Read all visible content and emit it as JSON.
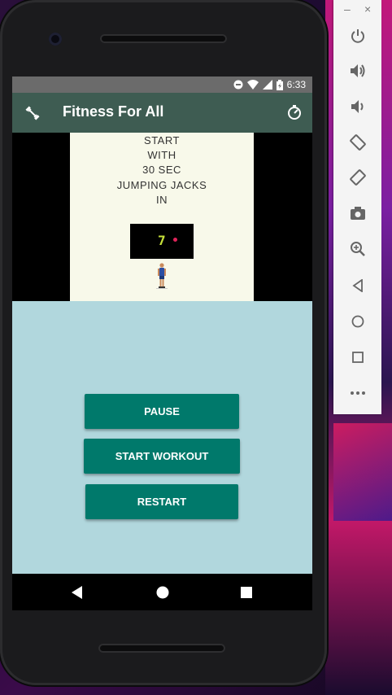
{
  "status_bar": {
    "time": "6:33"
  },
  "app_bar": {
    "title": "Fitness For All"
  },
  "exercise_card": {
    "lines": [
      "START",
      "WITH",
      "30 SEC",
      "JUMPING JACKS",
      "IN"
    ],
    "countdown": "7"
  },
  "buttons": {
    "pause": "PAUSE",
    "start_workout": "START WORKOUT",
    "restart": "RESTART"
  },
  "emulator_toolbar": {
    "minimize": "–",
    "close": "×",
    "items": [
      "power-icon",
      "volume-up-icon",
      "volume-down-icon",
      "rotate-left-icon",
      "rotate-right-icon",
      "camera-icon",
      "zoom-icon",
      "back-icon",
      "home-icon",
      "overview-icon",
      "more-icon"
    ]
  },
  "colors": {
    "app_bar": "#3e5c52",
    "button": "#00796b",
    "controls_bg": "#b1d7dd",
    "card_bg": "#f8f9ea",
    "timer_digit": "#c6e03a"
  }
}
